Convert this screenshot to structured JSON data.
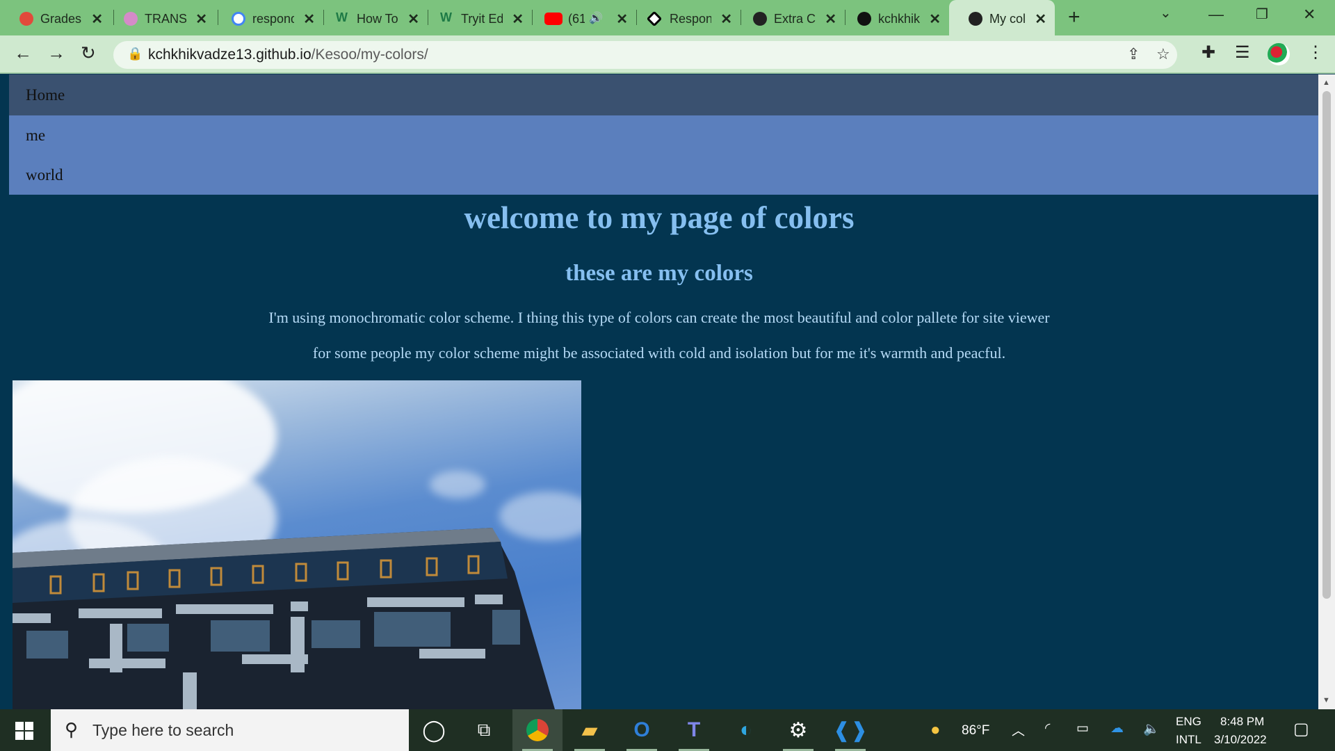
{
  "browser": {
    "tabs": [
      {
        "title": "Grades",
        "favicon": "canvas-icon",
        "color": "#e24a3b"
      },
      {
        "title": "TRANSLATE",
        "favicon": "translate-icon",
        "color": "#d58bc8"
      },
      {
        "title": "respond",
        "favicon": "google-icon",
        "color": "#4285f4"
      },
      {
        "title": "How To",
        "favicon": "w3-icon",
        "color": "#2e8b57"
      },
      {
        "title": "Tryit Editor",
        "favicon": "w3-icon",
        "color": "#2e8b57"
      },
      {
        "title": "(61",
        "favicon": "youtube-icon",
        "color": "#ff0000"
      },
      {
        "title": "Respon",
        "favicon": "codepen-icon",
        "color": "#000000"
      },
      {
        "title": "Extra C",
        "favicon": "globe-icon",
        "color": "#222222"
      },
      {
        "title": "kchkhik",
        "favicon": "github-icon",
        "color": "#111111"
      },
      {
        "title": "My col",
        "favicon": "globe-icon",
        "color": "#222222",
        "active": true
      }
    ],
    "url_host": "kchkhikvadze13.github.io",
    "url_path": "/Kesoo/my-colors/"
  },
  "site": {
    "nav": [
      "Home",
      "me",
      "world"
    ],
    "title": "welcome to my page of colors",
    "subtitle": "these are my colors",
    "para1": "I'm using monochromatic color scheme. I thing this type of colors can create the most beautiful and color pallete for site viewer",
    "para2": "for some people my color scheme might be associated with cold and isolation but for me it's warmth and peacful.",
    "colors": {
      "background": "#033550",
      "nav_home": "#3a5170",
      "nav_sub": "#5b7fbd",
      "heading": "#86bff0",
      "text": "#b6dbf7"
    }
  },
  "taskbar": {
    "search_placeholder": "Type here to search",
    "weather": "86°F",
    "lang_top": "ENG",
    "lang_bottom": "INTL",
    "time": "8:48 PM",
    "date": "3/10/2022"
  }
}
